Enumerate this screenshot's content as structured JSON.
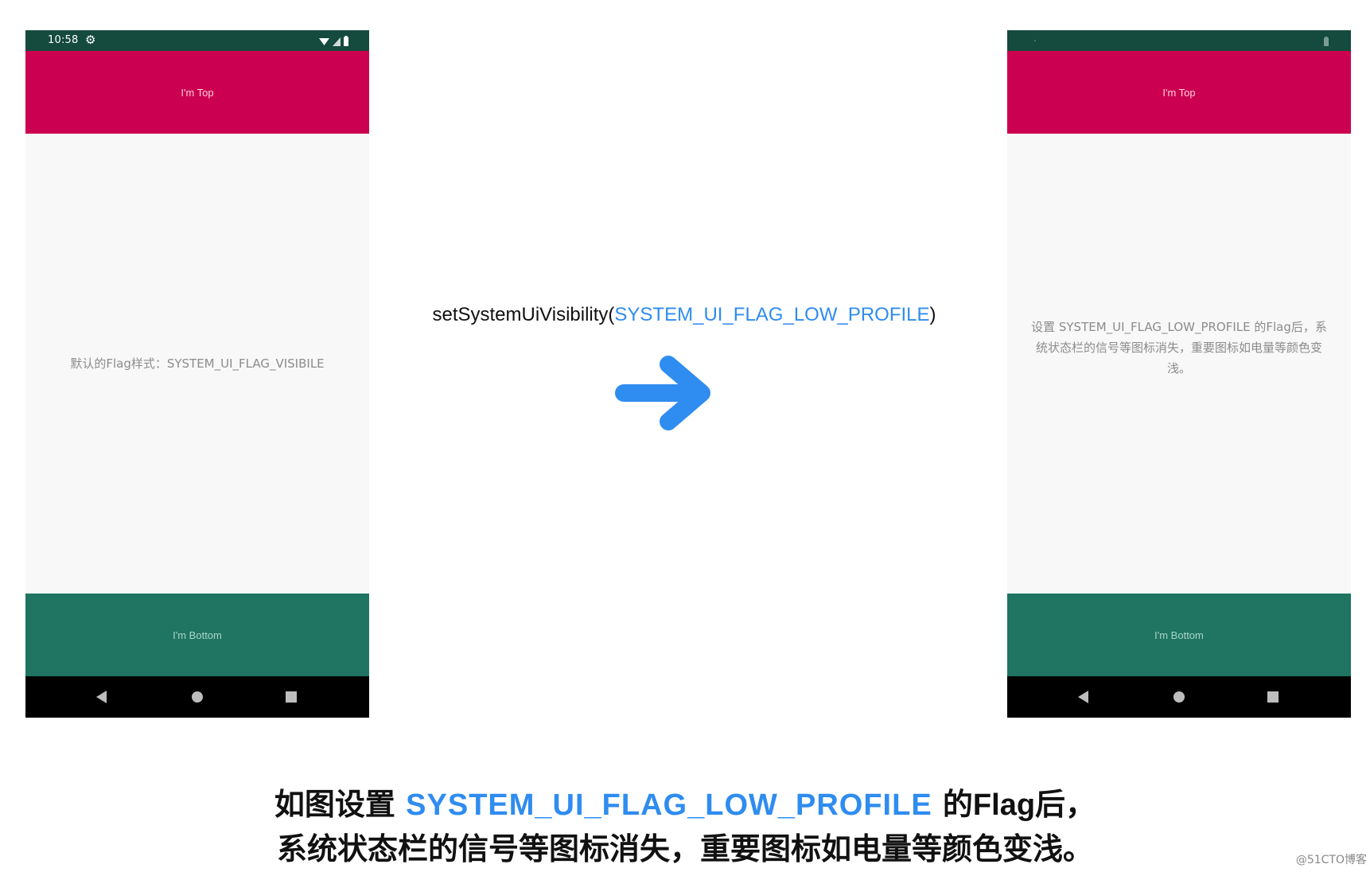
{
  "left_phone": {
    "status_time": "10:58",
    "top_label": "I'm Top",
    "message": "默认的Flag样式：SYSTEM_UI_FLAG_VISIBILE",
    "bottom_label": "I'm Bottom"
  },
  "right_phone": {
    "top_label": "I'm Top",
    "message": "设置 SYSTEM_UI_FLAG_LOW_PROFILE 的Flag后，系统状态栏的信号等图标消失，重要图标如电量等颜色变浅。",
    "bottom_label": "I'm Bottom"
  },
  "code": {
    "prefix": "setSystemUiVisibility(",
    "flag": "SYSTEM_UI_FLAG_LOW_PROFILE",
    "suffix": ")"
  },
  "caption": {
    "line1_a": "如图设置 ",
    "line1_flag": "SYSTEM_UI_FLAG_LOW_PROFILE",
    "line1_b": " 的",
    "line1_c": "Flag",
    "line1_d": "后，",
    "line2": "系统状态栏的信号等图标消失，重要图标如电量等颜色变浅。"
  },
  "watermark": "@51CTO博客",
  "colors": {
    "status_bar": "#154a3e",
    "top_bar": "#cc0050",
    "bottom_bar": "#1f7462",
    "nav_bar": "#000000",
    "accent_blue": "#2f8cf0"
  },
  "icons": {
    "settings": "gear-icon",
    "wifi": "wifi-icon",
    "signal": "signal-icon",
    "battery": "battery-icon",
    "back": "back-triangle-icon",
    "home": "home-circle-icon",
    "recents": "recents-square-icon",
    "arrow": "arrow-right-icon"
  }
}
